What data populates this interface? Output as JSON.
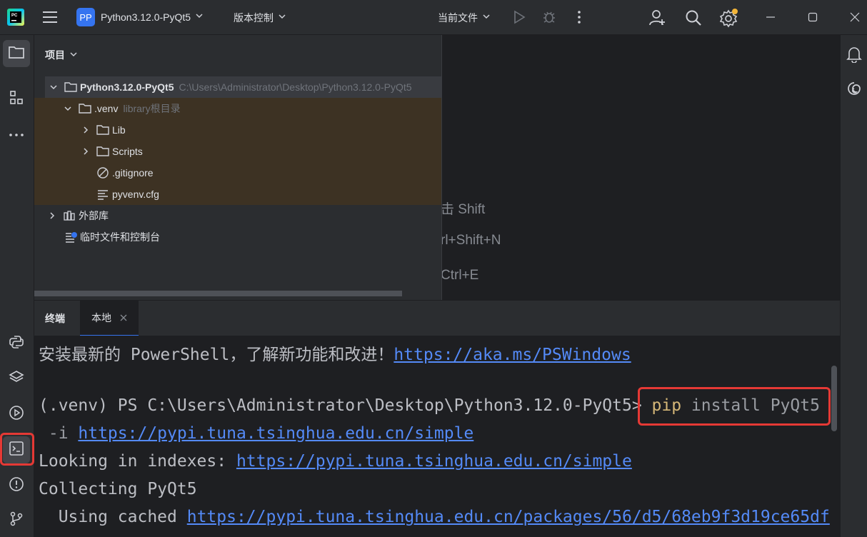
{
  "titlebar": {
    "project_badge": "PP",
    "project_name": "Python3.12.0-PyQt5",
    "vcs_label": "版本控制",
    "run_config": "当前文件"
  },
  "project_panel": {
    "header": "项目",
    "tree": [
      {
        "label": "Python3.12.0-PyQt5",
        "hint": "C:\\Users\\Administrator\\Desktop\\Python3.12.0-PyQt5"
      },
      {
        "label": ".venv",
        "hint": "library根目录"
      },
      {
        "label": "Lib"
      },
      {
        "label": "Scripts"
      },
      {
        "label": ".gitignore"
      },
      {
        "label": "pyvenv.cfg"
      },
      {
        "label": "外部库"
      },
      {
        "label": "临时文件和控制台"
      }
    ]
  },
  "editor_hints": [
    "击 Shift",
    "rl+Shift+N",
    "Ctrl+E"
  ],
  "terminal": {
    "tab_title": "终端",
    "tab_local": "本地",
    "lines": {
      "l1_text": "安装最新的 PowerShell，了解新功能和改进！",
      "l1_link": "https://aka.ms/PSWindows",
      "l2_prompt": "(.venv) PS C:\\Users\\Administrator\\Desktop\\Python3.12.0-PyQt5> ",
      "l2_cmd": "pip",
      "l2_args": " install PyQt5",
      "l3_flag": " -i ",
      "l3_link": "https://pypi.tuna.tsinghua.edu.cn/simple",
      "l4_text": "Looking in indexes: ",
      "l4_link": "https://pypi.tuna.tsinghua.edu.cn/simple",
      "l5_text": "Collecting PyQt5",
      "l6_text": "  Using cached ",
      "l6_link": "https://pypi.tuna.tsinghua.edu.cn/packages/56/d5/68eb9f3d19ce65df"
    }
  },
  "colors": {
    "accent": "#3574f0",
    "highlight_box": "#e53935",
    "link": "#548af7",
    "command": "#d5b778"
  }
}
